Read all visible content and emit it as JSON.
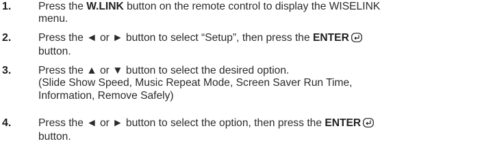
{
  "steps": [
    {
      "number": "1.",
      "lines": [
        {
          "pre": "Press the ",
          "bold": "W.LINK",
          "post": " button on the remote control to display the WISELINK"
        },
        {
          "text": "menu."
        }
      ]
    },
    {
      "number": "2.",
      "lines": [
        {
          "pre": "Press the ◄ or ► button to select “Setup”, then press the ",
          "bold": "ENTER",
          "icon": "enter-icon"
        },
        {
          "text": "button."
        }
      ]
    },
    {
      "number": "3.",
      "lines": [
        {
          "text": "Press the ▲ or ▼ button to select the desired option."
        },
        {
          "text": "(Slide Show Speed, Music Repeat Mode, Screen Saver Run Time,"
        },
        {
          "text": "Information, Remove Safely)"
        }
      ]
    },
    {
      "number": "4.",
      "lines": [
        {
          "pre": "Press the ◄ or ► button to select the option, then press the ",
          "bold": "ENTER",
          "icon": "enter-icon"
        },
        {
          "text": "button."
        }
      ]
    }
  ]
}
